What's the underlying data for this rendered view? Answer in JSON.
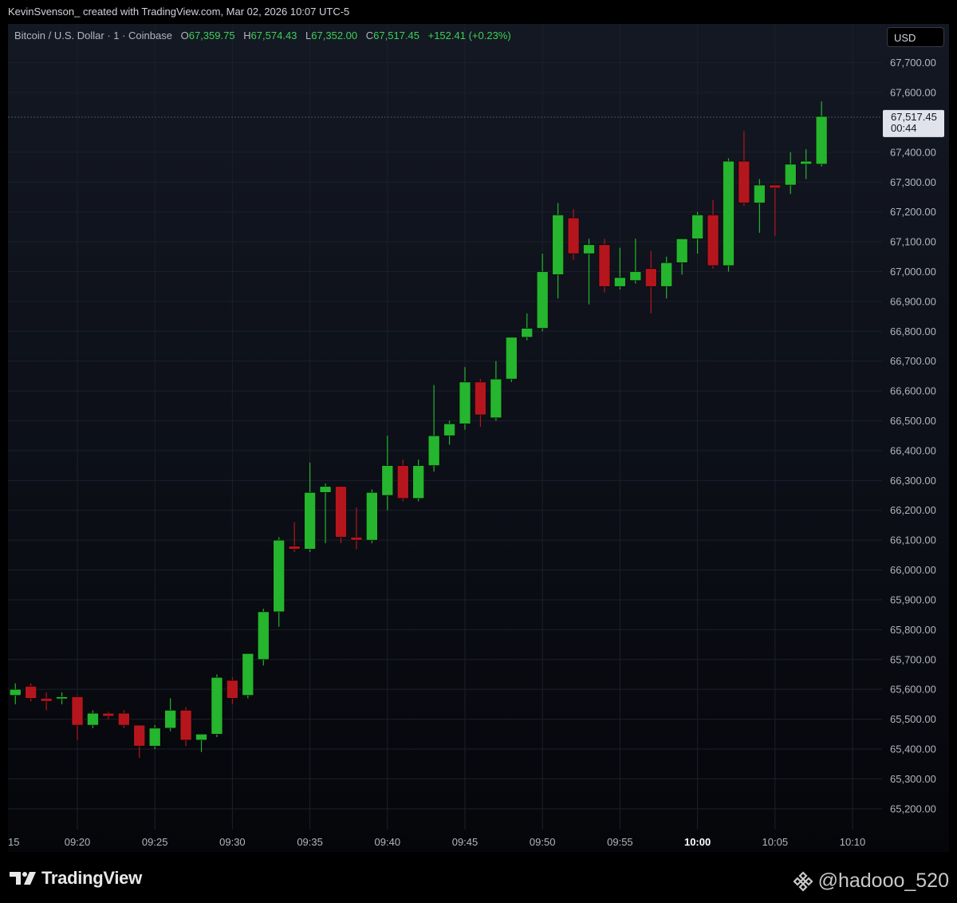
{
  "header": {
    "caption": "KevinSvenson_ created with TradingView.com, Mar 02, 2026 10:07 UTC-5"
  },
  "legend": {
    "symbol": "Bitcoin / U.S. Dollar · 1 · Coinbase",
    "o_label": "O",
    "o_value": "67,359.75",
    "h_label": "H",
    "h_value": "67,574.43",
    "l_label": "L",
    "l_value": "67,352.00",
    "c_label": "C",
    "c_value": "67,517.45",
    "change": "+152.41 (+0.23%)"
  },
  "currency_button": "USD",
  "price_tag": {
    "price": "67,517.45",
    "countdown": "00:44"
  },
  "footer": {
    "brand": "TradingView",
    "watermark": "@hadooo_520",
    "watermark_icon": "binance-diamond-icon"
  },
  "colors": {
    "up": "#25b52e",
    "down": "#b5161e",
    "bg_top": "#141823",
    "bg_bottom": "#05060a"
  },
  "chart_data": {
    "type": "candlestick",
    "interval": "1 minute",
    "x_tick_labels": [
      "15",
      "09:20",
      "09:25",
      "09:30",
      "09:35",
      "09:40",
      "09:45",
      "09:50",
      "09:55",
      "10:00",
      "10:05",
      "10:10"
    ],
    "x_ticks_minutes": [
      -5,
      0,
      5,
      10,
      15,
      20,
      25,
      30,
      35,
      40,
      45,
      50
    ],
    "bold_tick": "10:00",
    "y_tick_labels": [
      "67,700.00",
      "67,600.00",
      "67,400.00",
      "67,300.00",
      "67,200.00",
      "67,100.00",
      "67,000.00",
      "66,900.00",
      "66,800.00",
      "66,700.00",
      "66,600.00",
      "66,500.00",
      "66,400.00",
      "66,300.00",
      "66,200.00",
      "66,100.00",
      "66,000.00",
      "65,900.00",
      "65,800.00",
      "65,700.00",
      "65,600.00",
      "65,500.00",
      "65,400.00",
      "65,300.00",
      "65,200.00"
    ],
    "y_tick_values": [
      67700,
      67600,
      67400,
      67300,
      67200,
      67100,
      67000,
      66900,
      66800,
      66700,
      66600,
      66500,
      66400,
      66300,
      66200,
      66100,
      66000,
      65900,
      65800,
      65700,
      65600,
      65500,
      65400,
      65300,
      65200
    ],
    "ylim": [
      65130,
      67830
    ],
    "last_price": 67517.45,
    "candles": [
      {
        "t": "09:16",
        "o": 65580,
        "h": 65620,
        "l": 65550,
        "c": 65600
      },
      {
        "t": "09:17",
        "o": 65610,
        "h": 65620,
        "l": 65560,
        "c": 65570
      },
      {
        "t": "09:18",
        "o": 65570,
        "h": 65590,
        "l": 65530,
        "c": 65560
      },
      {
        "t": "09:19",
        "o": 65570,
        "h": 65590,
        "l": 65550,
        "c": 65575
      },
      {
        "t": "09:20",
        "o": 65575,
        "h": 65580,
        "l": 65430,
        "c": 65480
      },
      {
        "t": "09:21",
        "o": 65480,
        "h": 65530,
        "l": 65470,
        "c": 65520
      },
      {
        "t": "09:22",
        "o": 65520,
        "h": 65525,
        "l": 65500,
        "c": 65510
      },
      {
        "t": "09:23",
        "o": 65520,
        "h": 65530,
        "l": 65470,
        "c": 65480
      },
      {
        "t": "09:24",
        "o": 65480,
        "h": 65480,
        "l": 65370,
        "c": 65410
      },
      {
        "t": "09:25",
        "o": 65410,
        "h": 65480,
        "l": 65400,
        "c": 65470
      },
      {
        "t": "09:26",
        "o": 65470,
        "h": 65570,
        "l": 65460,
        "c": 65530
      },
      {
        "t": "09:27",
        "o": 65530,
        "h": 65540,
        "l": 65410,
        "c": 65430
      },
      {
        "t": "09:28",
        "o": 65430,
        "h": 65450,
        "l": 65390,
        "c": 65450
      },
      {
        "t": "09:29",
        "o": 65450,
        "h": 65650,
        "l": 65440,
        "c": 65640
      },
      {
        "t": "09:30",
        "o": 65630,
        "h": 65640,
        "l": 65550,
        "c": 65570
      },
      {
        "t": "09:31",
        "o": 65580,
        "h": 65720,
        "l": 65570,
        "c": 65720
      },
      {
        "t": "09:32",
        "o": 65700,
        "h": 65870,
        "l": 65680,
        "c": 65860
      },
      {
        "t": "09:33",
        "o": 65860,
        "h": 66110,
        "l": 65810,
        "c": 66100
      },
      {
        "t": "09:34",
        "o": 66080,
        "h": 66160,
        "l": 66060,
        "c": 66070
      },
      {
        "t": "09:35",
        "o": 66070,
        "h": 66360,
        "l": 66060,
        "c": 66260
      },
      {
        "t": "09:36",
        "o": 66260,
        "h": 66290,
        "l": 66090,
        "c": 66280
      },
      {
        "t": "09:37",
        "o": 66280,
        "h": 66280,
        "l": 66090,
        "c": 66110
      },
      {
        "t": "09:38",
        "o": 66110,
        "h": 66210,
        "l": 66070,
        "c": 66100
      },
      {
        "t": "09:39",
        "o": 66100,
        "h": 66270,
        "l": 66090,
        "c": 66260
      },
      {
        "t": "09:40",
        "o": 66250,
        "h": 66450,
        "l": 66200,
        "c": 66350
      },
      {
        "t": "09:41",
        "o": 66350,
        "h": 66370,
        "l": 66230,
        "c": 66240
      },
      {
        "t": "09:42",
        "o": 66240,
        "h": 66370,
        "l": 66230,
        "c": 66350
      },
      {
        "t": "09:43",
        "o": 66350,
        "h": 66620,
        "l": 66330,
        "c": 66450
      },
      {
        "t": "09:44",
        "o": 66450,
        "h": 66500,
        "l": 66420,
        "c": 66490
      },
      {
        "t": "09:45",
        "o": 66490,
        "h": 66680,
        "l": 66470,
        "c": 66630
      },
      {
        "t": "09:46",
        "o": 66630,
        "h": 66640,
        "l": 66480,
        "c": 66520
      },
      {
        "t": "09:47",
        "o": 66510,
        "h": 66700,
        "l": 66500,
        "c": 66640
      },
      {
        "t": "09:48",
        "o": 66640,
        "h": 66760,
        "l": 66630,
        "c": 66780
      },
      {
        "t": "09:49",
        "o": 66780,
        "h": 66860,
        "l": 66770,
        "c": 66810
      },
      {
        "t": "09:50",
        "o": 66810,
        "h": 67060,
        "l": 66800,
        "c": 67000
      },
      {
        "t": "09:51",
        "o": 66990,
        "h": 67230,
        "l": 66910,
        "c": 67190
      },
      {
        "t": "09:52",
        "o": 67180,
        "h": 67210,
        "l": 67040,
        "c": 67060
      },
      {
        "t": "09:53",
        "o": 67060,
        "h": 67110,
        "l": 66890,
        "c": 67090
      },
      {
        "t": "09:54",
        "o": 67090,
        "h": 67110,
        "l": 66930,
        "c": 66950
      },
      {
        "t": "09:55",
        "o": 66950,
        "h": 67080,
        "l": 66940,
        "c": 66980
      },
      {
        "t": "09:56",
        "o": 66970,
        "h": 67110,
        "l": 66960,
        "c": 67000
      },
      {
        "t": "09:57",
        "o": 67010,
        "h": 67070,
        "l": 66860,
        "c": 66950
      },
      {
        "t": "09:58",
        "o": 66950,
        "h": 67050,
        "l": 66910,
        "c": 67030
      },
      {
        "t": "09:59",
        "o": 67030,
        "h": 67090,
        "l": 66990,
        "c": 67110
      },
      {
        "t": "10:00",
        "o": 67110,
        "h": 67200,
        "l": 67060,
        "c": 67190
      },
      {
        "t": "10:01",
        "o": 67190,
        "h": 67240,
        "l": 67010,
        "c": 67020
      },
      {
        "t": "10:02",
        "o": 67020,
        "h": 67380,
        "l": 67000,
        "c": 67370
      },
      {
        "t": "10:03",
        "o": 67370,
        "h": 67470,
        "l": 67220,
        "c": 67230
      },
      {
        "t": "10:04",
        "o": 67230,
        "h": 67310,
        "l": 67130,
        "c": 67290
      },
      {
        "t": "10:05",
        "o": 67290,
        "h": 67290,
        "l": 67120,
        "c": 67280
      },
      {
        "t": "10:06",
        "o": 67290,
        "h": 67400,
        "l": 67260,
        "c": 67360
      },
      {
        "t": "10:07",
        "o": 67360,
        "h": 67410,
        "l": 67310,
        "c": 67370
      },
      {
        "t": "10:08",
        "o": 67360,
        "h": 67570,
        "l": 67352,
        "c": 67520
      }
    ]
  }
}
